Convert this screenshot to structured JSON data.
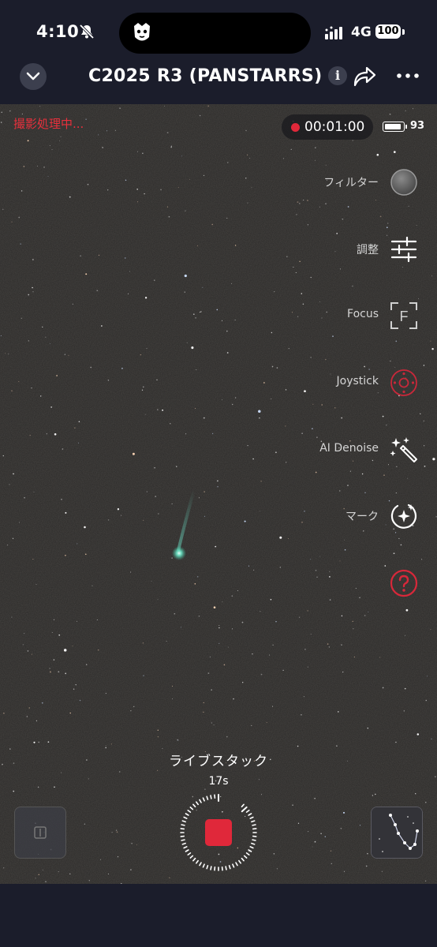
{
  "status_bar": {
    "time": "4:10",
    "network": "4G",
    "battery": "100",
    "icons": [
      "bell-slash-icon",
      "cellular-signal-icon",
      "island-app-icon"
    ]
  },
  "header": {
    "title": "C2025 R3 (PANSTARRS)",
    "info_label": "i",
    "icons": [
      "chevron-down-icon",
      "share-icon",
      "more-icon"
    ]
  },
  "capture": {
    "status_text": "撮影処理中...",
    "recording_time": "00:01:00",
    "device_battery": "93",
    "device_battery_level": 0.93,
    "mode_label": "ライブスタック",
    "exposure": "17s"
  },
  "tools": [
    {
      "label": "フィルター",
      "icon": "filter-wheel-icon"
    },
    {
      "label": "調整",
      "icon": "sliders-icon"
    },
    {
      "label": "Focus",
      "icon": "focus-icon"
    },
    {
      "label": "Joystick",
      "icon": "joystick-icon"
    },
    {
      "label": "AI Denoise",
      "icon": "magic-wand-icon"
    },
    {
      "label": "マーク",
      "icon": "mark-star-icon"
    },
    {
      "label": "",
      "icon": "help-icon"
    }
  ],
  "colors": {
    "accent_red": "#e0283a",
    "background": "#1b1d2b",
    "sky": "#262626",
    "comet": "#7fffd4"
  }
}
